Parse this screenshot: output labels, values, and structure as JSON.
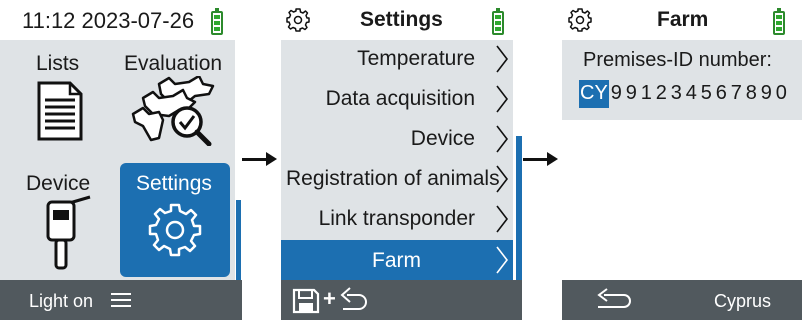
{
  "screen1": {
    "status_time": "11:12 2023-07-26",
    "tiles": {
      "lists": "Lists",
      "evaluation": "Evaluation",
      "device": "Device",
      "settings": "Settings"
    },
    "bottom": {
      "light_label": "Light on"
    }
  },
  "screen2": {
    "title": "Settings",
    "menu": [
      {
        "label": "Temperature"
      },
      {
        "label": "Data acquisition"
      },
      {
        "label": "Device"
      },
      {
        "label": "Registration of animals"
      },
      {
        "label": "Link transponder"
      },
      {
        "label": "Farm"
      }
    ],
    "selected_index": 5,
    "bottom": {
      "plus": "+"
    }
  },
  "screen3": {
    "title": "Farm",
    "field_label": "Premises-ID number:",
    "country_code": "CY",
    "digits": "991234567890",
    "bottom": {
      "country": "Cyprus"
    }
  },
  "colors": {
    "accent": "#1c6fb1",
    "panel": "#dfe3e6",
    "bar": "#51595e",
    "battery": "#2ea82e"
  }
}
